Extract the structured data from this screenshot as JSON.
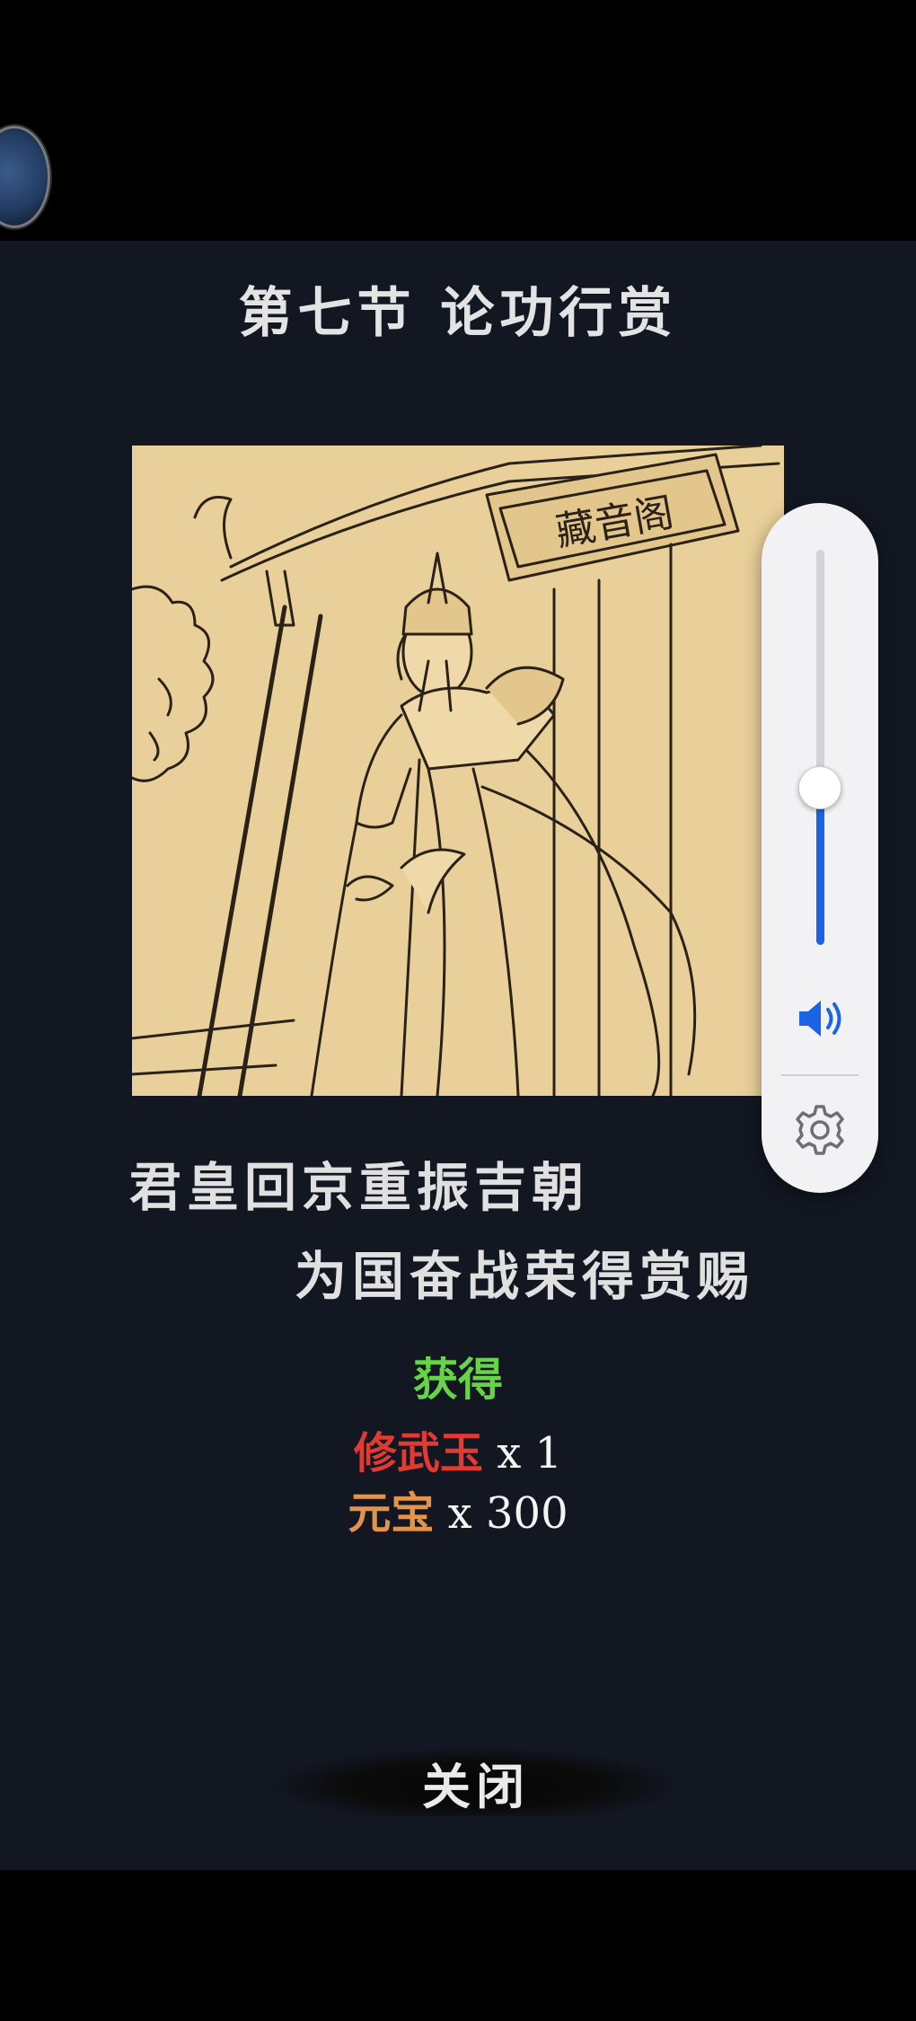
{
  "dialog": {
    "title": "第七节 论功行赏",
    "poem_line_1": "君皇回京重振吉朝",
    "poem_line_2": "为国奋战荣得赏赐",
    "sign_text": "藏音阁"
  },
  "rewards": {
    "heading": "获得",
    "items": [
      {
        "name": "修武玉",
        "quantity": "x 1"
      },
      {
        "name": "元宝",
        "quantity": "x 300"
      }
    ]
  },
  "close_label": "关闭",
  "volume": {
    "level": 0.4,
    "icons": [
      "speaker-icon",
      "gear-icon"
    ]
  },
  "colors": {
    "panel_bg": "#121722",
    "heading_green": "#66d348",
    "item_red": "#e03a32",
    "item_orange": "#e3944a",
    "slider_blue": "#1a63e6",
    "illustration_bg": "#e9d09a"
  }
}
